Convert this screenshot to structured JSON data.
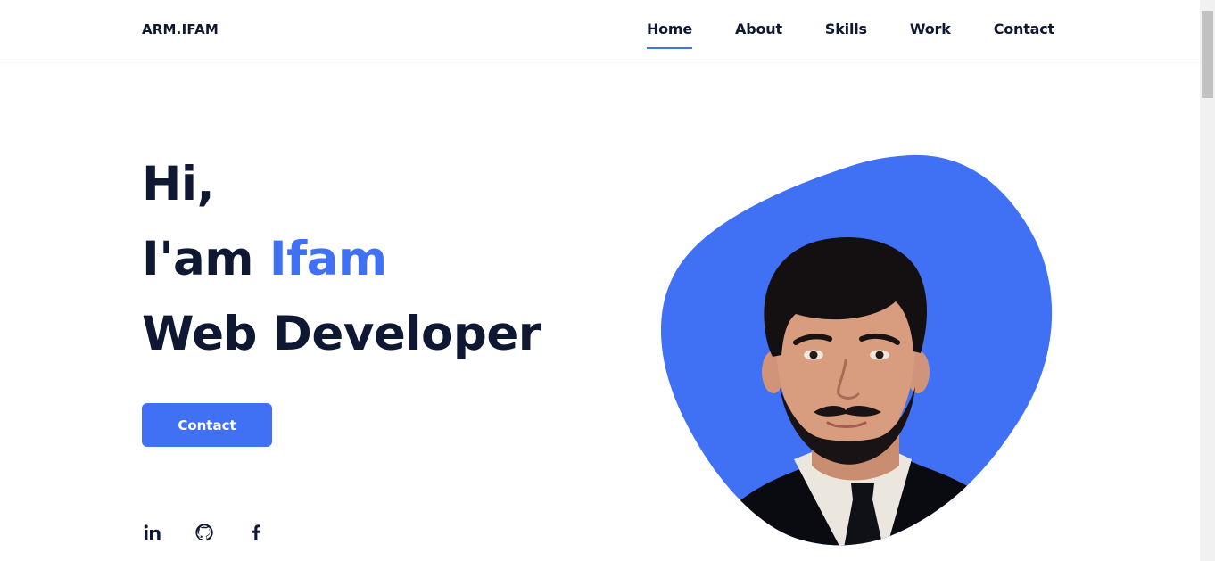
{
  "header": {
    "logo": "ARM.IFAM",
    "nav": [
      {
        "label": "Home",
        "active": true
      },
      {
        "label": "About",
        "active": false
      },
      {
        "label": "Skills",
        "active": false
      },
      {
        "label": "Work",
        "active": false
      },
      {
        "label": "Contact",
        "active": false
      }
    ]
  },
  "hero": {
    "greeting": "Hi,",
    "intro_prefix": "I'am",
    "name": "Ifam",
    "role": "Web Developer",
    "cta_label": "Contact"
  },
  "socials": [
    {
      "icon": "linkedin-icon",
      "glyph": "in"
    },
    {
      "icon": "github-icon",
      "glyph": "github"
    },
    {
      "icon": "facebook-icon",
      "glyph": "f"
    }
  ],
  "colors": {
    "accent": "#4070f4",
    "text": "#0f1833",
    "background": "#ffffff"
  }
}
